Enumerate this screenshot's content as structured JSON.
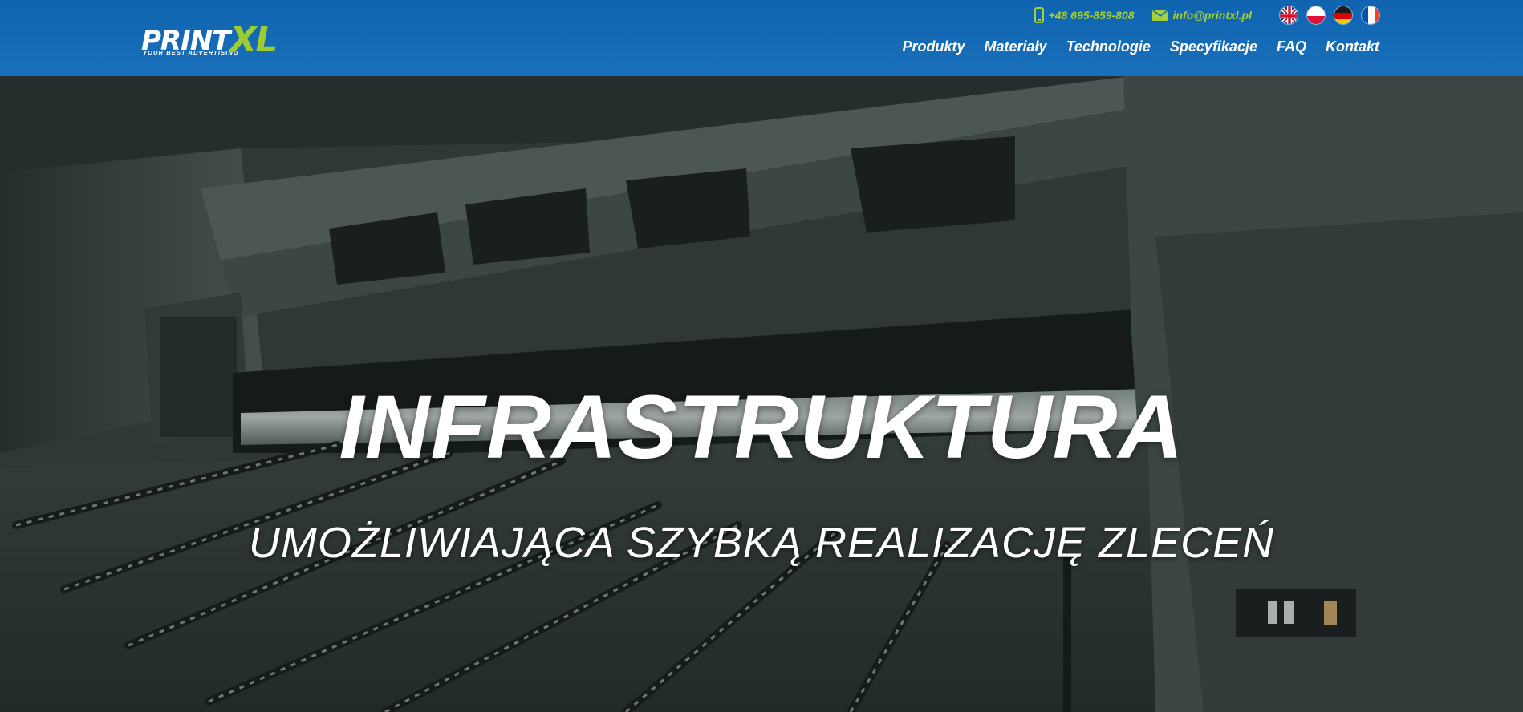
{
  "brand": {
    "name_part1": "PRINT",
    "name_part2": "XL",
    "tagline": "YOUR BEST ADVERTISING"
  },
  "contact": {
    "phone": "+48 695-859-808",
    "email": "info@printxl.pl",
    "phone_icon": "phone-icon",
    "email_icon": "envelope-icon"
  },
  "languages": [
    {
      "code": "en",
      "flag": "uk-flag-icon"
    },
    {
      "code": "pl",
      "flag": "poland-flag-icon"
    },
    {
      "code": "de",
      "flag": "germany-flag-icon"
    },
    {
      "code": "fr",
      "flag": "france-flag-icon"
    }
  ],
  "nav": {
    "items": [
      {
        "label": "Produkty"
      },
      {
        "label": "Materiały"
      },
      {
        "label": "Technologie"
      },
      {
        "label": "Specyfikacje"
      },
      {
        "label": "FAQ"
      },
      {
        "label": "Kontakt"
      }
    ]
  },
  "hero": {
    "title": "INFRASTRUKTURA",
    "subtitle": "UMOŻLIWIAJĄCA SZYBKĄ REALIZACJĘ ZLECEŃ"
  },
  "colors": {
    "header_bg": "#1467b3",
    "accent_green": "#9ccc2f",
    "text_white": "#ffffff"
  }
}
